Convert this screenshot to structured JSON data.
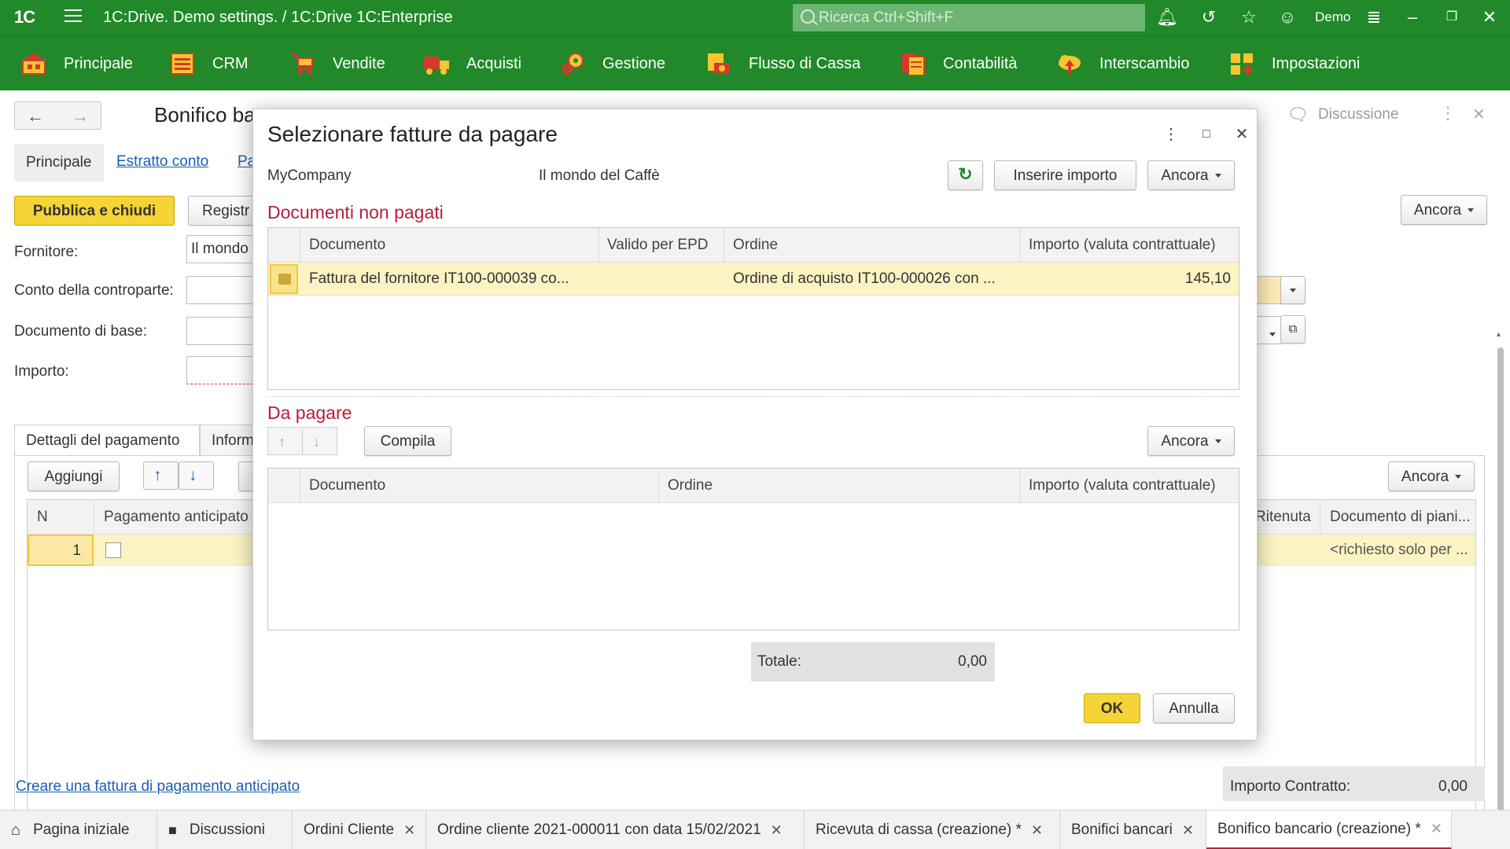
{
  "app": {
    "logo": "1С",
    "title": "1C:Drive. Demo settings. / 1C:Drive 1C:Enterprise",
    "search_placeholder": "Ricerca Ctrl+Shift+F",
    "user": "Demo",
    "accent": "#21892a",
    "top_icons": [
      "bell-icon",
      "history-icon",
      "star-icon",
      "user-icon",
      "menu-filter-icon",
      "minimize-icon",
      "restore-icon",
      "close-icon"
    ]
  },
  "sections": [
    {
      "label": "Principale",
      "icon": "home-section-icon"
    },
    {
      "label": "CRM",
      "icon": "crm-section-icon"
    },
    {
      "label": "Vendite",
      "icon": "cart-section-icon"
    },
    {
      "label": "Acquisti",
      "icon": "truck-section-icon"
    },
    {
      "label": "Gestione",
      "icon": "gears-section-icon"
    },
    {
      "label": "Flusso di Cassa",
      "icon": "cash-section-icon"
    },
    {
      "label": "Contabilità",
      "icon": "ledger-section-icon"
    },
    {
      "label": "Interscambio",
      "icon": "cloud-section-icon"
    },
    {
      "label": "Impostazioni",
      "icon": "settings-section-icon"
    }
  ],
  "form": {
    "title": "Bonifico ba",
    "tab_principale": "Principale",
    "tab_estratto": "Estratto conto",
    "tab_pa": "Pa",
    "publish_button": "Pubblica e chiudi",
    "register_button": "Registr",
    "ancora": "Ancora",
    "discussione": "Discussione",
    "fornitore_label": "Fornitore:",
    "fornitore_value": "Il mondo",
    "conto_label": "Conto della controparte:",
    "documento_label": "Documento di base:",
    "importo_label": "Importo:",
    "tab_dettagli": "Dettagli del pagamento",
    "tab_inform": "Inform",
    "aggiungi": "Aggiungi",
    "col_n": "N",
    "col_pagamento": "Pagamento anticipato",
    "col_ritenuta": "Ritenuta",
    "col_docpiani": "Documento di piani...",
    "row_n": "1",
    "row_docpiani": "<richiesto solo per ...",
    "link_fattura": "Creare una fattura di pagamento anticipato",
    "importo_contratto_label": "Importo Contratto:",
    "importo_contratto_value": "0,00"
  },
  "dialog": {
    "title": "Selezionare fatture da pagare",
    "company": "MyCompany",
    "counterparty": "Il mondo del Caffè",
    "inserire_importo": "Inserire importo",
    "ancora": "Ancora",
    "unpaid_title": "Documenti non pagati",
    "unpaid_columns": {
      "documento": "Documento",
      "valido": "Valido per EPD",
      "ordine": "Ordine",
      "importo": "Importo (valuta contrattuale)"
    },
    "unpaid_rows": [
      {
        "documento": "Fattura del fornitore IT100-000039 co...",
        "valido": "",
        "ordine": "Ordine di acquisto IT100-000026 con ...",
        "importo": "145,10"
      }
    ],
    "topay_title": "Da pagare",
    "compila": "Compila",
    "topay_columns": {
      "documento": "Documento",
      "ordine": "Ordine",
      "importo": "Importo (valuta contrattuale)"
    },
    "totale_label": "Totale:",
    "totale_value": "0,00",
    "ok": "OK",
    "annulla": "Annulla"
  },
  "bottom_tabs": [
    {
      "label": "Pagina iniziale",
      "icon": "home-icon",
      "closable": false
    },
    {
      "label": "Discussioni",
      "icon": "chat-icon",
      "closable": false
    },
    {
      "label": "Ordini Cliente",
      "closable": true
    },
    {
      "label": "Ordine cliente 2021-000011 con data 15/02/2021",
      "closable": true
    },
    {
      "label": "Ricevuta di cassa (creazione) *",
      "closable": true
    },
    {
      "label": "Bonifici bancari",
      "closable": true
    },
    {
      "label": "Bonifico bancario (creazione) *",
      "closable": true,
      "active": true
    }
  ]
}
